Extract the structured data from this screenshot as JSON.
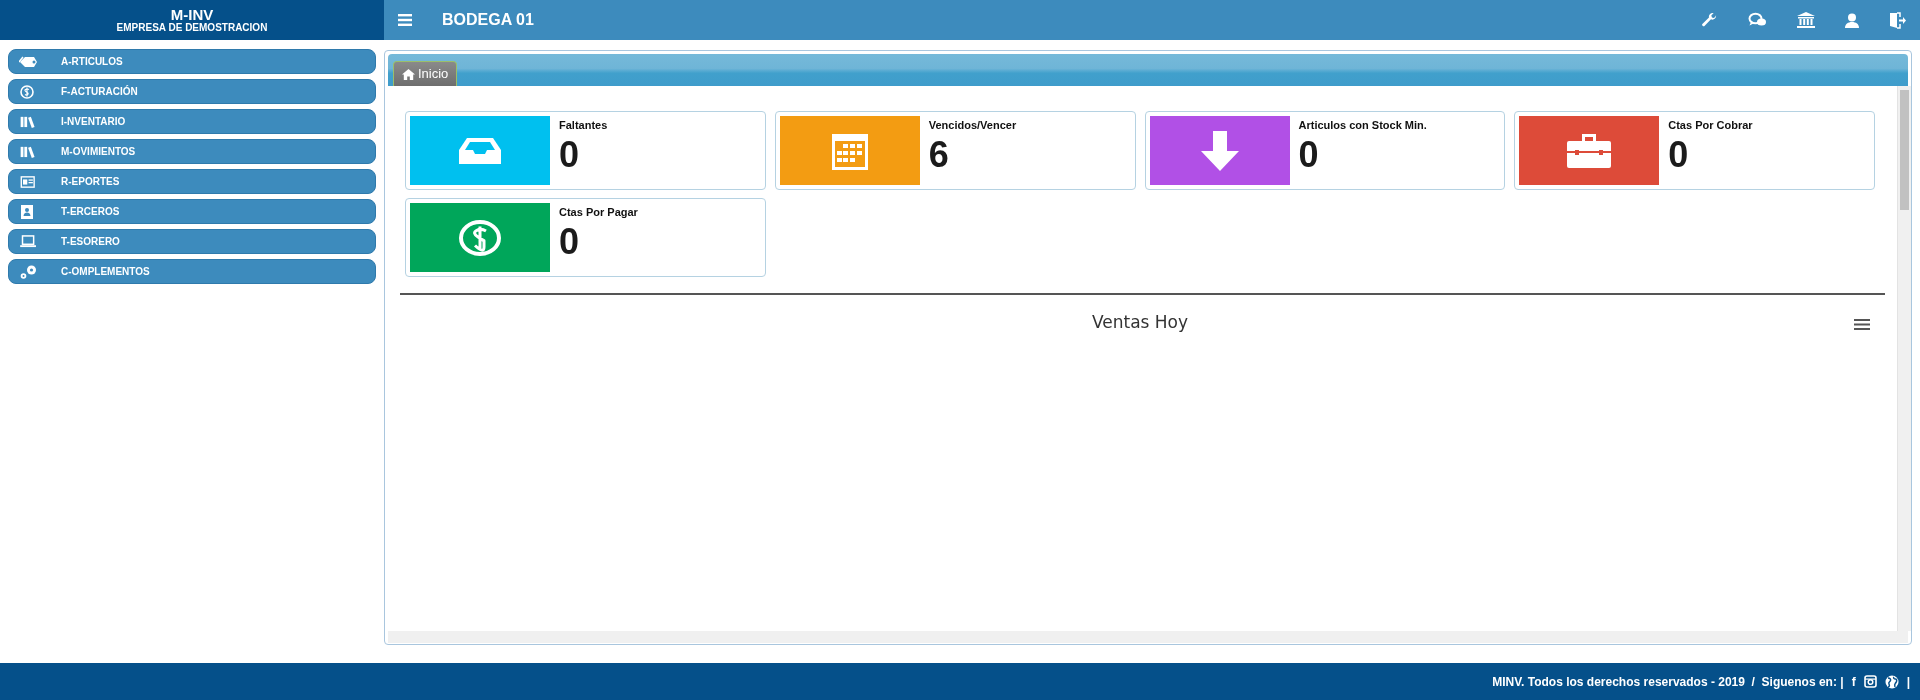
{
  "header": {
    "app_name": "M-INV",
    "company": "EMPRESA DE DEMOSTRACION",
    "title": "BODEGA 01"
  },
  "sidebar": {
    "items": [
      {
        "label": "A-RTICULOS"
      },
      {
        "label": "F-ACTURACIÓN"
      },
      {
        "label": "I-NVENTARIO"
      },
      {
        "label": "M-OVIMIENTOS"
      },
      {
        "label": "R-EPORTES"
      },
      {
        "label": "T-ERCEROS"
      },
      {
        "label": "T-ESORERO"
      },
      {
        "label": "C-OMPLEMENTOS"
      }
    ]
  },
  "tabs": [
    {
      "label": "Inicio",
      "selected": true
    }
  ],
  "tiles": [
    {
      "label": "Faltantes",
      "value": "0",
      "color": "#00c0ef"
    },
    {
      "label": "Vencidos/Vencer",
      "value": "6",
      "color": "#f39c12"
    },
    {
      "label": "Articulos con Stock Min.",
      "value": "0",
      "color": "#b150e6"
    },
    {
      "label": "Ctas Por Cobrar",
      "value": "0",
      "color": "#dd4b39"
    },
    {
      "label": "Ctas Por Pagar",
      "value": "0",
      "color": "#00a65a"
    }
  ],
  "chart": {
    "title": "Ventas Hoy"
  },
  "footer": {
    "text": "MINV. Todos los derechos reservados - 2019  /  Siguenos en: |",
    "facebook": "f",
    "end": "|"
  }
}
